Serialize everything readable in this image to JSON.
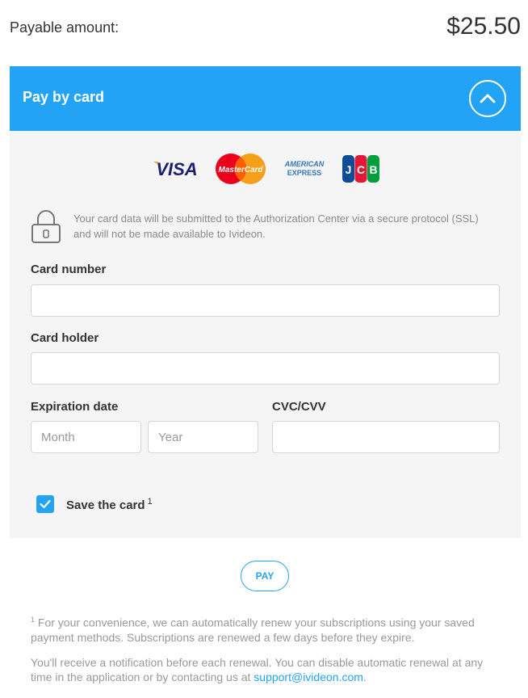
{
  "payment": {
    "label": "Payable amount:",
    "amount": "$25.50"
  },
  "card_section": {
    "title": "Pay by card",
    "logos": [
      "VISA",
      "MasterCard",
      "AMERICAN EXPRESS",
      "JCB"
    ],
    "security_note": "Your card data will be submitted to the Authorization Center via a secure protocol (SSL) and will not be made available to Ivideon."
  },
  "form": {
    "card_number": {
      "label": "Card number",
      "value": "",
      "placeholder": ""
    },
    "card_holder": {
      "label": "Card holder",
      "value": "",
      "placeholder": ""
    },
    "expiration": {
      "label": "Expiration date",
      "month_placeholder": "Month",
      "year_placeholder": "Year"
    },
    "cvc": {
      "label": "CVC/CVV",
      "value": "",
      "placeholder": ""
    },
    "save_card": {
      "label": "Save the card",
      "footnote_mark": "1",
      "checked": true
    }
  },
  "actions": {
    "pay_label": "PAY"
  },
  "footer": {
    "note1_mark": "1",
    "note1": "For your convenience, we can automatically renew your subscriptions using your saved payment methods. Subscriptions are renewed a few days before they expire.",
    "note2": "You'll receive a notification before each renewal. You can disable automatic renewal at any time in the application or by contacting us at",
    "support_email": "support@ivideon.com",
    "note2_end": "."
  },
  "colors": {
    "accent": "#22a3f5",
    "panel_bg": "#f5f5f5"
  }
}
